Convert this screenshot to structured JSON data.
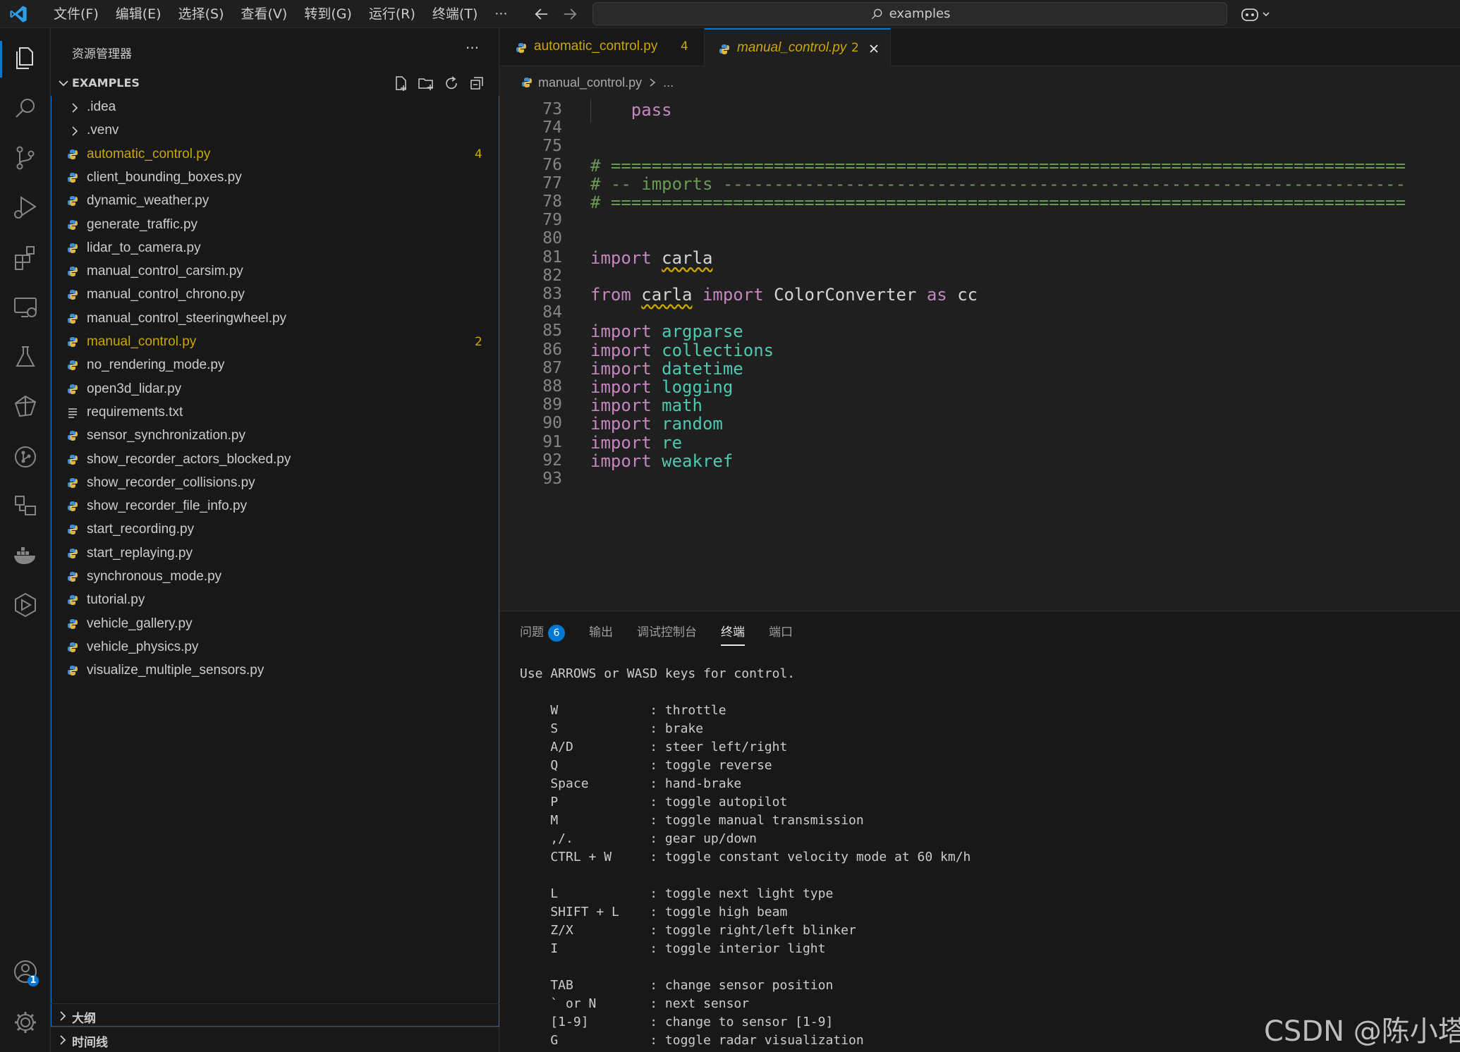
{
  "titlebar": {
    "menu": [
      "文件(F)",
      "编辑(E)",
      "选择(S)",
      "查看(V)",
      "转到(G)",
      "运行(R)",
      "终端(T)",
      "···"
    ],
    "search_text": "examples"
  },
  "sidebar": {
    "title": "资源管理器",
    "more": "···",
    "section_label": "EXAMPLES",
    "files": [
      {
        "name": ".idea",
        "type": "folder"
      },
      {
        "name": ".venv",
        "type": "folder"
      },
      {
        "name": "automatic_control.py",
        "type": "py",
        "warn": true,
        "badge": "4"
      },
      {
        "name": "client_bounding_boxes.py",
        "type": "py"
      },
      {
        "name": "dynamic_weather.py",
        "type": "py"
      },
      {
        "name": "generate_traffic.py",
        "type": "py"
      },
      {
        "name": "lidar_to_camera.py",
        "type": "py"
      },
      {
        "name": "manual_control_carsim.py",
        "type": "py"
      },
      {
        "name": "manual_control_chrono.py",
        "type": "py"
      },
      {
        "name": "manual_control_steeringwheel.py",
        "type": "py"
      },
      {
        "name": "manual_control.py",
        "type": "py",
        "warn": true,
        "badge": "2"
      },
      {
        "name": "no_rendering_mode.py",
        "type": "py"
      },
      {
        "name": "open3d_lidar.py",
        "type": "py"
      },
      {
        "name": "requirements.txt",
        "type": "txt"
      },
      {
        "name": "sensor_synchronization.py",
        "type": "py"
      },
      {
        "name": "show_recorder_actors_blocked.py",
        "type": "py"
      },
      {
        "name": "show_recorder_collisions.py",
        "type": "py"
      },
      {
        "name": "show_recorder_file_info.py",
        "type": "py"
      },
      {
        "name": "start_recording.py",
        "type": "py"
      },
      {
        "name": "start_replaying.py",
        "type": "py"
      },
      {
        "name": "synchronous_mode.py",
        "type": "py"
      },
      {
        "name": "tutorial.py",
        "type": "py"
      },
      {
        "name": "vehicle_gallery.py",
        "type": "py"
      },
      {
        "name": "vehicle_physics.py",
        "type": "py"
      },
      {
        "name": "visualize_multiple_sensors.py",
        "type": "py"
      }
    ],
    "outline_label": "大纲",
    "timeline_label": "时间线"
  },
  "editor": {
    "tabs": [
      {
        "label": "automatic_control.py",
        "badge": "4"
      },
      {
        "label": "manual_control.py",
        "badge": "2"
      }
    ],
    "breadcrumb": {
      "file": "manual_control.py",
      "rest": "..."
    },
    "lines": [
      {
        "n": "73",
        "parts": [
          {
            "t": "    pass",
            "c": "kw"
          }
        ]
      },
      {
        "n": "74",
        "parts": []
      },
      {
        "n": "75",
        "parts": []
      },
      {
        "n": "76",
        "parts": [
          {
            "t": "# ==============================================================================",
            "c": "cmt"
          }
        ]
      },
      {
        "n": "77",
        "parts": [
          {
            "t": "# -- imports -------------------------------------------------------------------",
            "c": "cmt"
          }
        ]
      },
      {
        "n": "78",
        "parts": [
          {
            "t": "# ==============================================================================",
            "c": "cmt"
          }
        ]
      },
      {
        "n": "79",
        "parts": []
      },
      {
        "n": "80",
        "parts": []
      },
      {
        "n": "81",
        "parts": [
          {
            "t": "import",
            "c": "kw"
          },
          {
            "t": " ",
            "c": "plain"
          },
          {
            "t": "carla",
            "c": "plain squig"
          }
        ]
      },
      {
        "n": "82",
        "parts": []
      },
      {
        "n": "83",
        "parts": [
          {
            "t": "from",
            "c": "kw"
          },
          {
            "t": " ",
            "c": "plain"
          },
          {
            "t": "carla",
            "c": "plain squig"
          },
          {
            "t": " ",
            "c": "plain"
          },
          {
            "t": "import",
            "c": "kw"
          },
          {
            "t": " ColorConverter ",
            "c": "plain"
          },
          {
            "t": "as",
            "c": "kw"
          },
          {
            "t": " cc",
            "c": "plain"
          }
        ]
      },
      {
        "n": "84",
        "parts": []
      },
      {
        "n": "85",
        "parts": [
          {
            "t": "import",
            "c": "kw"
          },
          {
            "t": " argparse",
            "c": "mod"
          }
        ]
      },
      {
        "n": "86",
        "parts": [
          {
            "t": "import",
            "c": "kw"
          },
          {
            "t": " collections",
            "c": "mod"
          }
        ]
      },
      {
        "n": "87",
        "parts": [
          {
            "t": "import",
            "c": "kw"
          },
          {
            "t": " datetime",
            "c": "mod"
          }
        ]
      },
      {
        "n": "88",
        "parts": [
          {
            "t": "import",
            "c": "kw"
          },
          {
            "t": " logging",
            "c": "mod"
          }
        ]
      },
      {
        "n": "89",
        "parts": [
          {
            "t": "import",
            "c": "kw"
          },
          {
            "t": " math",
            "c": "mod"
          }
        ]
      },
      {
        "n": "90",
        "parts": [
          {
            "t": "import",
            "c": "kw"
          },
          {
            "t": " random",
            "c": "mod"
          }
        ]
      },
      {
        "n": "91",
        "parts": [
          {
            "t": "import",
            "c": "kw"
          },
          {
            "t": " re",
            "c": "mod"
          }
        ]
      },
      {
        "n": "92",
        "parts": [
          {
            "t": "import",
            "c": "kw"
          },
          {
            "t": " weakref",
            "c": "mod"
          }
        ]
      },
      {
        "n": "93",
        "parts": []
      }
    ]
  },
  "panel": {
    "tabs": [
      {
        "label": "问题",
        "badge": "6"
      },
      {
        "label": "输出"
      },
      {
        "label": "调试控制台"
      },
      {
        "label": "终端",
        "active": true
      },
      {
        "label": "端口"
      }
    ],
    "terminal_lines": [
      "Use ARROWS or WASD keys for control.",
      "",
      "    W            : throttle",
      "    S            : brake",
      "    A/D          : steer left/right",
      "    Q            : toggle reverse",
      "    Space        : hand-brake",
      "    P            : toggle autopilot",
      "    M            : toggle manual transmission",
      "    ,/.          : gear up/down",
      "    CTRL + W     : toggle constant velocity mode at 60 km/h",
      "",
      "    L            : toggle next light type",
      "    SHIFT + L    : toggle high beam",
      "    Z/X          : toggle right/left blinker",
      "    I            : toggle interior light",
      "",
      "    TAB          : change sensor position",
      "    ` or N       : next sensor",
      "    [1-9]        : change to sensor [1-9]",
      "    G            : toggle radar visualization"
    ]
  },
  "accounts_badge": "1",
  "watermark": "CSDN @陈小塔",
  "colors": {
    "accent": "#0078d4",
    "warning": "#cca700",
    "keyword": "#c586c0",
    "module": "#4ec9b0",
    "comment": "#6a9955"
  }
}
